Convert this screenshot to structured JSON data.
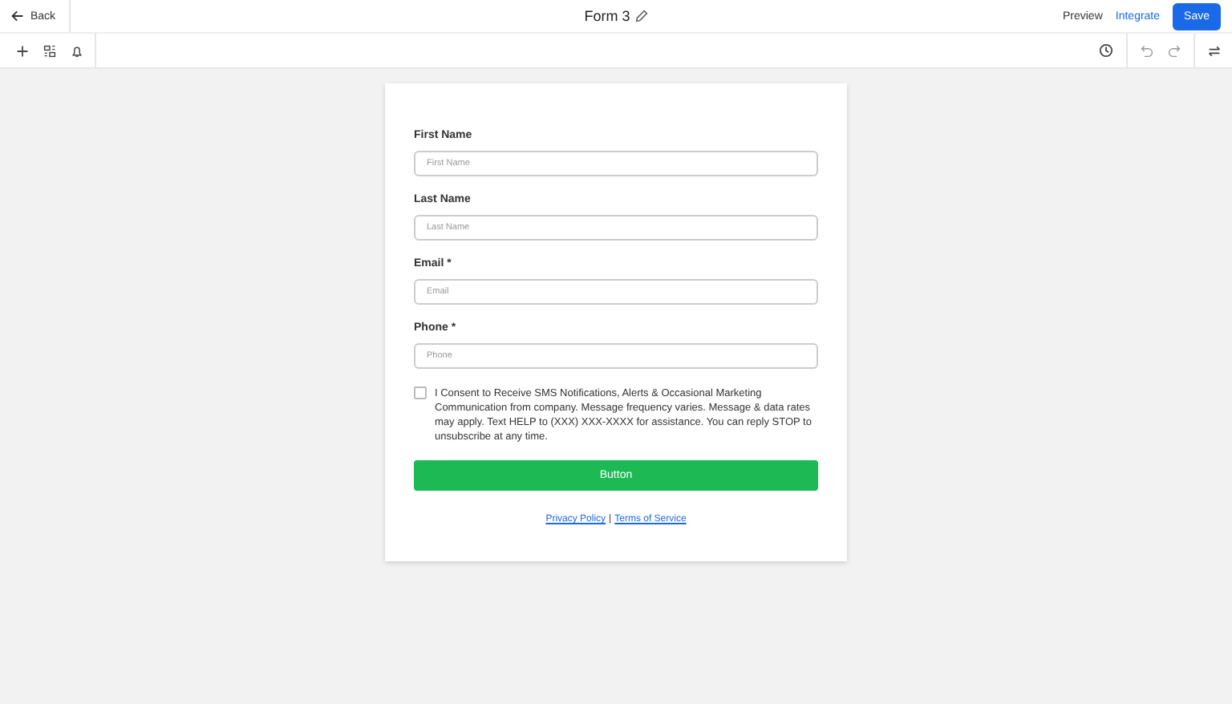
{
  "header": {
    "back": "Back",
    "title": "Form 3",
    "preview": "Preview",
    "integrate": "Integrate",
    "save": "Save"
  },
  "form": {
    "fields": [
      {
        "label": "First Name",
        "placeholder": "First Name"
      },
      {
        "label": "Last Name",
        "placeholder": "Last Name"
      },
      {
        "label": "Email *",
        "placeholder": "Email"
      },
      {
        "label": "Phone *",
        "placeholder": "Phone"
      }
    ],
    "consent": {
      "checked": false,
      "text": "I Consent to Receive SMS Notifications, Alerts & Occasional Marketing Communication from company. Message frequency varies. Message & data rates may apply. Text HELP to (XXX) XXX-XXXX for assistance. You can reply STOP to unsubscribe at any time."
    },
    "submit": "Button",
    "links": [
      "Privacy Policy",
      "Terms of Service"
    ],
    "separator": "|"
  }
}
